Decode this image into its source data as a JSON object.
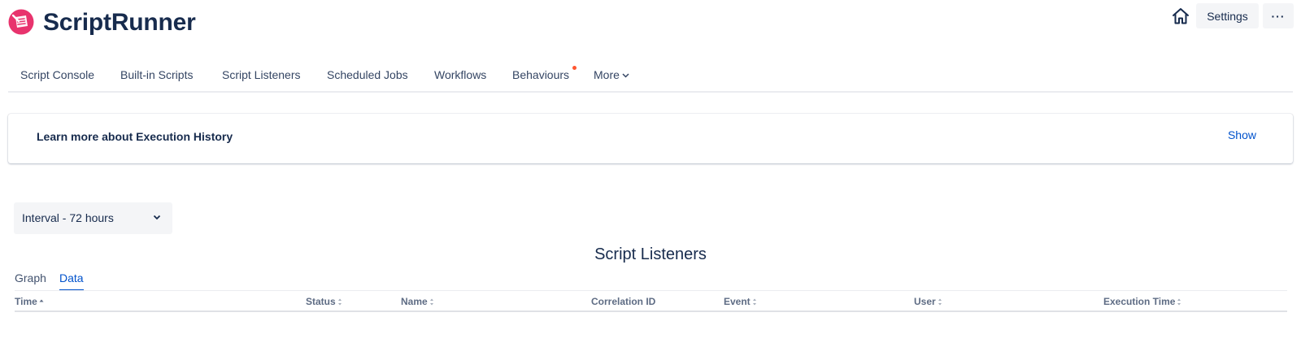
{
  "header": {
    "brand": "ScriptRunner",
    "logo_icon": "scriptrunner-logo-icon",
    "home_icon": "home-icon",
    "settings_label": "Settings",
    "more_label": "···"
  },
  "nav": {
    "items": [
      {
        "label": "Script Console"
      },
      {
        "label": "Built-in Scripts"
      },
      {
        "label": "Script Listeners"
      },
      {
        "label": "Scheduled Jobs"
      },
      {
        "label": "Workflows"
      },
      {
        "label": "Behaviours",
        "has_dot": true
      },
      {
        "label": "More",
        "has_dropdown": true
      }
    ]
  },
  "info_panel": {
    "title": "Learn more about Execution History",
    "action": "Show"
  },
  "interval": {
    "selected": "Interval - 72 hours"
  },
  "section_title": "Script Listeners",
  "tabs": [
    {
      "label": "Graph",
      "active": false
    },
    {
      "label": "Data",
      "active": true
    }
  ],
  "table": {
    "columns": [
      {
        "label": "Time",
        "sorted": "asc"
      },
      {
        "label": "Status",
        "sortable": true
      },
      {
        "label": "Name",
        "sortable": true
      },
      {
        "label": "Correlation ID",
        "sortable": false
      },
      {
        "label": "Event",
        "sortable": true
      },
      {
        "label": "User",
        "sortable": true
      },
      {
        "label": "Execution Time",
        "sortable": true
      }
    ]
  },
  "colors": {
    "brand_pink": "#e8336d",
    "link_blue": "#0052cc",
    "text_dark": "#172b4d",
    "notification_dot": "#ff5630"
  }
}
